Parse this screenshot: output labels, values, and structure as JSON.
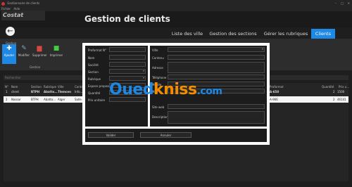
{
  "window": {
    "title": "Gestionnaire de clients"
  },
  "menu": [
    "Fichier",
    "Aide"
  ],
  "logo": "Costat",
  "app_title": "Gestion de clients",
  "nav": [
    {
      "label": "Liste des ville"
    },
    {
      "label": "Gestion des sections"
    },
    {
      "label": "Gérer les rubriques"
    },
    {
      "label": "Clients",
      "active": true
    }
  ],
  "ribbon": {
    "section_label": "Gestion",
    "sub_label": "Gestion",
    "buttons": [
      {
        "label": "Ajouter",
        "icon": "plus-icon"
      },
      {
        "label": "Modifier",
        "icon": "edit-icon"
      },
      {
        "label": "Supprimer",
        "icon": "trash-icon"
      },
      {
        "label": "Imprimer",
        "icon": "printer-icon"
      }
    ]
  },
  "search": {
    "placeholder": "Rechercher"
  },
  "table": {
    "headers": [
      "N°",
      "Nom",
      "Section",
      "Rubrique",
      "Ville",
      "Contact",
      "Proformat",
      "Quantité",
      "Prix u..."
    ],
    "rows": [
      [
        "1",
        "client",
        "BTPH",
        "Abatto...",
        "Tlemcen",
        "Info...",
        "A-658",
        "2",
        "1500"
      ],
      [
        "2",
        "Nassar",
        "BTPH",
        "Abatto...",
        "Alger",
        "Salle...",
        "A-966",
        "2",
        "46141"
      ]
    ]
  },
  "form": {
    "left_labels": [
      "Proformat N°",
      "Nom",
      "Société",
      "Section",
      "Rubrique",
      "Espace proposé",
      "Quantité",
      "Prix unitaire"
    ],
    "right_labels": [
      "Ville",
      "Contenu",
      "Adresse",
      "Téléphone",
      "Mobile",
      "Mail",
      "Site web",
      "Description"
    ],
    "save_label": "Valider",
    "cancel_label": "Annuler"
  },
  "watermark": {
    "part1": "Oued",
    "part2": "kniss",
    "part3": ".com"
  },
  "colors": {
    "accent": "#1e88e5",
    "background": "#1e1e1e",
    "dialog_border": "#ffffff"
  }
}
